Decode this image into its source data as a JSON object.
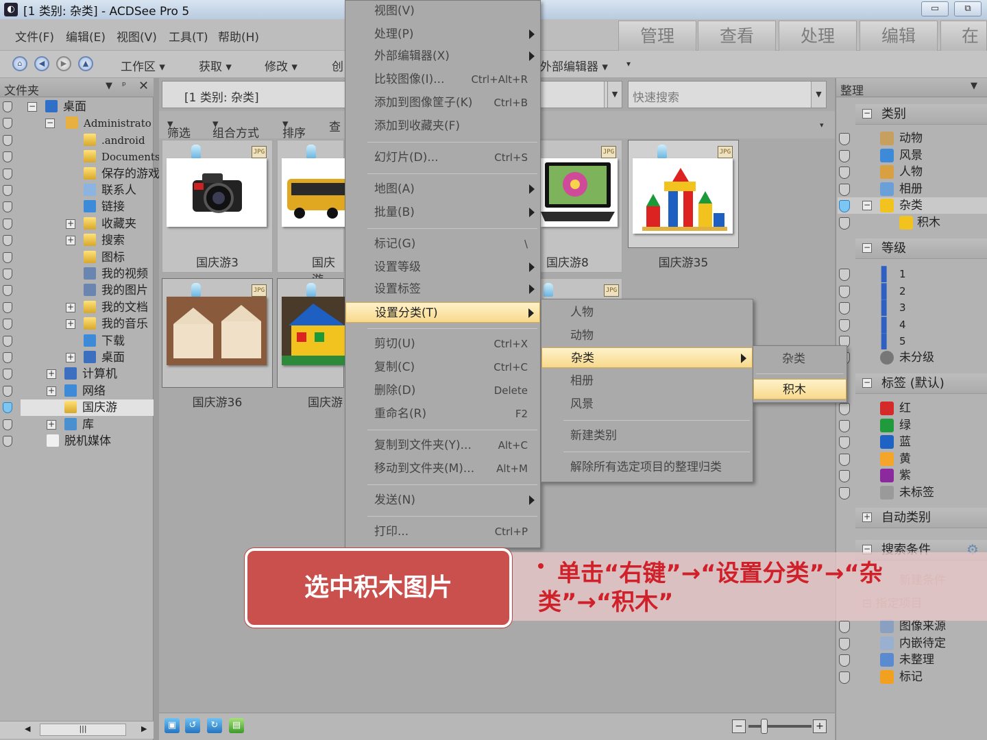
{
  "window": {
    "title": "[1 类别: 杂类] - ACDSee Pro 5",
    "minimize": "▭",
    "restore": "⧉"
  },
  "menubar": {
    "items": [
      "文件(F)",
      "编辑(E)",
      "视图(V)",
      "工具(T)",
      "帮助(H)"
    ]
  },
  "modes": [
    "管理",
    "查看",
    "处理",
    "编辑",
    "在线"
  ],
  "toolbar": {
    "items": [
      "工作区",
      "获取",
      "修改",
      "创"
    ],
    "external_editor": "外部编辑器"
  },
  "folder_panel": {
    "title": "文件夹",
    "tree": [
      {
        "label": "桌面",
        "expander": "−"
      },
      {
        "label": "Administrato",
        "expander": "−"
      },
      {
        "label": ".android"
      },
      {
        "label": "Documents"
      },
      {
        "label": "保存的游戏"
      },
      {
        "label": "联系人"
      },
      {
        "label": "链接"
      },
      {
        "label": "收藏夹",
        "expander": "+"
      },
      {
        "label": "搜索",
        "expander": "+"
      },
      {
        "label": "图标"
      },
      {
        "label": "我的视频"
      },
      {
        "label": "我的图片"
      },
      {
        "label": "我的文档",
        "expander": "+"
      },
      {
        "label": "我的音乐",
        "expander": "+"
      },
      {
        "label": "下载"
      },
      {
        "label": "桌面",
        "expander": "+"
      },
      {
        "label": "计算机",
        "expander": "+"
      },
      {
        "label": "网络",
        "expander": "+"
      },
      {
        "label": "国庆游"
      },
      {
        "label": "库",
        "expander": "+"
      },
      {
        "label": "脱机媒体"
      }
    ],
    "scroll_grip": "|||"
  },
  "browser": {
    "path": "[1 类别: 杂类]",
    "search_placeholder": "快速搜索",
    "filter_items": [
      "筛选",
      "组合方式",
      "排序",
      "查"
    ],
    "thumbnails": [
      {
        "caption": "国庆游3",
        "format": "JPG"
      },
      {
        "caption": "国庆游",
        "format": "JPG"
      },
      {
        "caption": "国庆游8",
        "format": "JPG"
      },
      {
        "caption": "国庆游35",
        "format": "JPG"
      },
      {
        "caption": "国庆游36",
        "format": "JPG"
      },
      {
        "caption": "国庆游",
        "format": "JPG"
      },
      {
        "caption": "",
        "format": "JPG"
      }
    ]
  },
  "context_menu": {
    "items": [
      {
        "label": "视图(V)",
        "shortcut": ""
      },
      {
        "label": "处理(P)",
        "shortcut": "",
        "submenu": true
      },
      {
        "label": "外部编辑器(X)",
        "shortcut": "",
        "submenu": true
      },
      {
        "label": "比较图像(I)...",
        "shortcut": "Ctrl+Alt+R"
      },
      {
        "label": "添加到图像筐子(K)",
        "shortcut": "Ctrl+B"
      },
      {
        "label": "添加到收藏夹(F)",
        "shortcut": ""
      },
      {
        "label": "幻灯片(D)...",
        "shortcut": "Ctrl+S"
      },
      {
        "label": "地图(A)",
        "shortcut": "",
        "submenu": true
      },
      {
        "label": "批量(B)",
        "shortcut": "",
        "submenu": true
      },
      {
        "label": "标记(G)",
        "shortcut": "\\"
      },
      {
        "label": "设置等级",
        "shortcut": "",
        "submenu": true
      },
      {
        "label": "设置标签",
        "shortcut": "",
        "submenu": true
      },
      {
        "label": "设置分类(T)",
        "shortcut": "",
        "submenu": true,
        "highlighted": true
      },
      {
        "label": "剪切(U)",
        "shortcut": "Ctrl+X"
      },
      {
        "label": "复制(C)",
        "shortcut": "Ctrl+C"
      },
      {
        "label": "删除(D)",
        "shortcut": "Delete"
      },
      {
        "label": "重命名(R)",
        "shortcut": "F2"
      },
      {
        "label": "复制到文件夹(Y)...",
        "shortcut": "Alt+C"
      },
      {
        "label": "移动到文件夹(M)...",
        "shortcut": "Alt+M"
      },
      {
        "label": "发送(N)",
        "shortcut": "",
        "submenu": true
      },
      {
        "label": "打印...",
        "shortcut": "Ctrl+P"
      }
    ]
  },
  "category_submenu": {
    "items": [
      "人物",
      "动物",
      "杂类",
      "相册",
      "风景",
      "新建类别",
      "解除所有选定项目的整理归类"
    ],
    "highlighted": "杂类"
  },
  "subcategory_submenu": {
    "items": [
      "杂类",
      "积木"
    ],
    "highlighted": "积木"
  },
  "organize_panel": {
    "title": "整理",
    "categories": {
      "header": "类别",
      "items": [
        "动物",
        "风景",
        "人物",
        "相册",
        "杂类",
        "积木"
      ]
    },
    "ratings": {
      "header": "等级",
      "items": [
        "1",
        "2",
        "3",
        "4",
        "5"
      ],
      "unrated": "未分级"
    },
    "labels": {
      "header": "标签 (默认)",
      "items": [
        {
          "name": "红",
          "color": "#d42a2a"
        },
        {
          "name": "绿",
          "color": "#1f9a3c"
        },
        {
          "name": "蓝",
          "color": "#1e63c4"
        },
        {
          "name": "黄",
          "color": "#f4a52a"
        },
        {
          "name": "紫",
          "color": "#8a2a9c"
        },
        {
          "name": "未标签",
          "color": "#9a9a9a"
        }
      ]
    },
    "auto_categories": "自动类别",
    "search_criteria": "搜索条件",
    "search_partial": "新建条件",
    "specified_items": "指定项目",
    "special_items": [
      "图像来源",
      "内嵌待定",
      "未整理",
      "标记"
    ]
  },
  "callout": {
    "title": "选中积木图片",
    "note": "单击“右键”→“设置分类”→“杂类”→“积木”"
  },
  "colors": {
    "highlight": "#f7d98c",
    "callout_red": "#c9504d",
    "note_text": "#d0202a"
  }
}
